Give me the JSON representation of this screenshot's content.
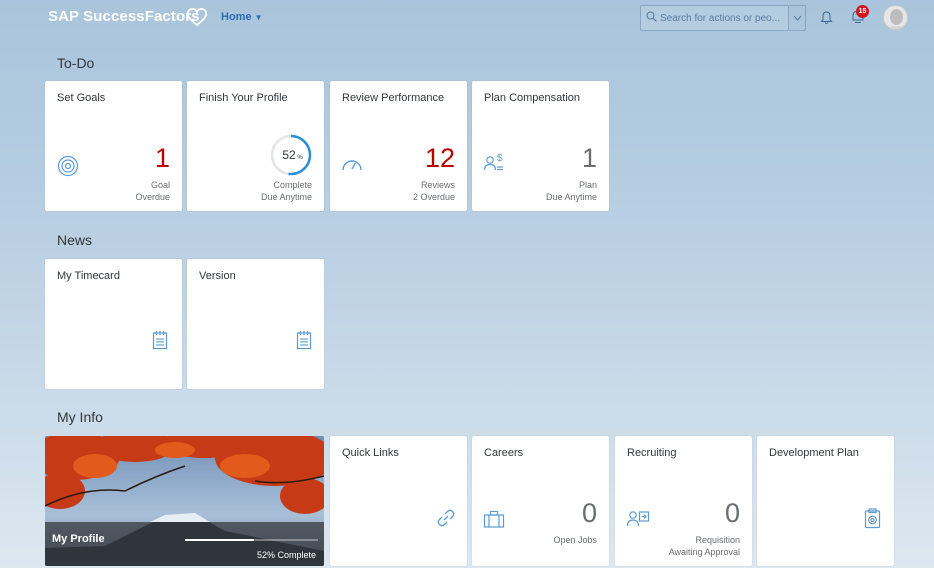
{
  "shell": {
    "logo": "SAP SuccessFactors",
    "home_menu": "Home",
    "search_placeholder": "Search for actions or peo...",
    "notification_count": "15",
    "accent": "#2e6db4"
  },
  "sections": {
    "todo": "To-Do",
    "news": "News",
    "myinfo": "My Info"
  },
  "todo_tiles": [
    {
      "title": "Set Goals",
      "number": "1",
      "foot1": "Goal",
      "foot2": "Overdue",
      "icon": "target-icon"
    },
    {
      "title": "Finish Your Profile",
      "ring_value": "52",
      "ring_unit": "%",
      "ring_fraction": 0.52,
      "foot1": "Complete",
      "foot2": "Due Anytime"
    },
    {
      "title": "Review Performance",
      "number": "12",
      "foot1": "Reviews",
      "foot2": "2 Overdue",
      "icon": "gauge-icon"
    },
    {
      "title": "Plan Compensation",
      "number": "1",
      "foot1": "Plan",
      "foot2": "Due Anytime",
      "icon": "compensation-icon"
    }
  ],
  "news_tiles": [
    {
      "title": "My Timecard",
      "icon": "timecard-icon"
    },
    {
      "title": "Version",
      "icon": "document-icon"
    }
  ],
  "myinfo": {
    "profile": {
      "name": "My Profile",
      "progress_text": "52% Complete",
      "progress": 0.52
    },
    "quick_links": {
      "title": "Quick Links",
      "icon": "link-icon"
    },
    "careers": {
      "title": "Careers",
      "number": "0",
      "foot": "Open Jobs",
      "icon": "briefcase-icon"
    },
    "recruiting": {
      "title": "Recruiting",
      "number": "0",
      "foot1": "Requisition",
      "foot2": "Awaiting Approval",
      "icon": "requisition-icon"
    },
    "development": {
      "title": "Development Plan",
      "icon": "clipboard-icon"
    }
  },
  "colors": {
    "overdue_red": "#bb0000",
    "icon_blue": "#5b9bd5",
    "ring_blue": "#2b8fd6"
  }
}
